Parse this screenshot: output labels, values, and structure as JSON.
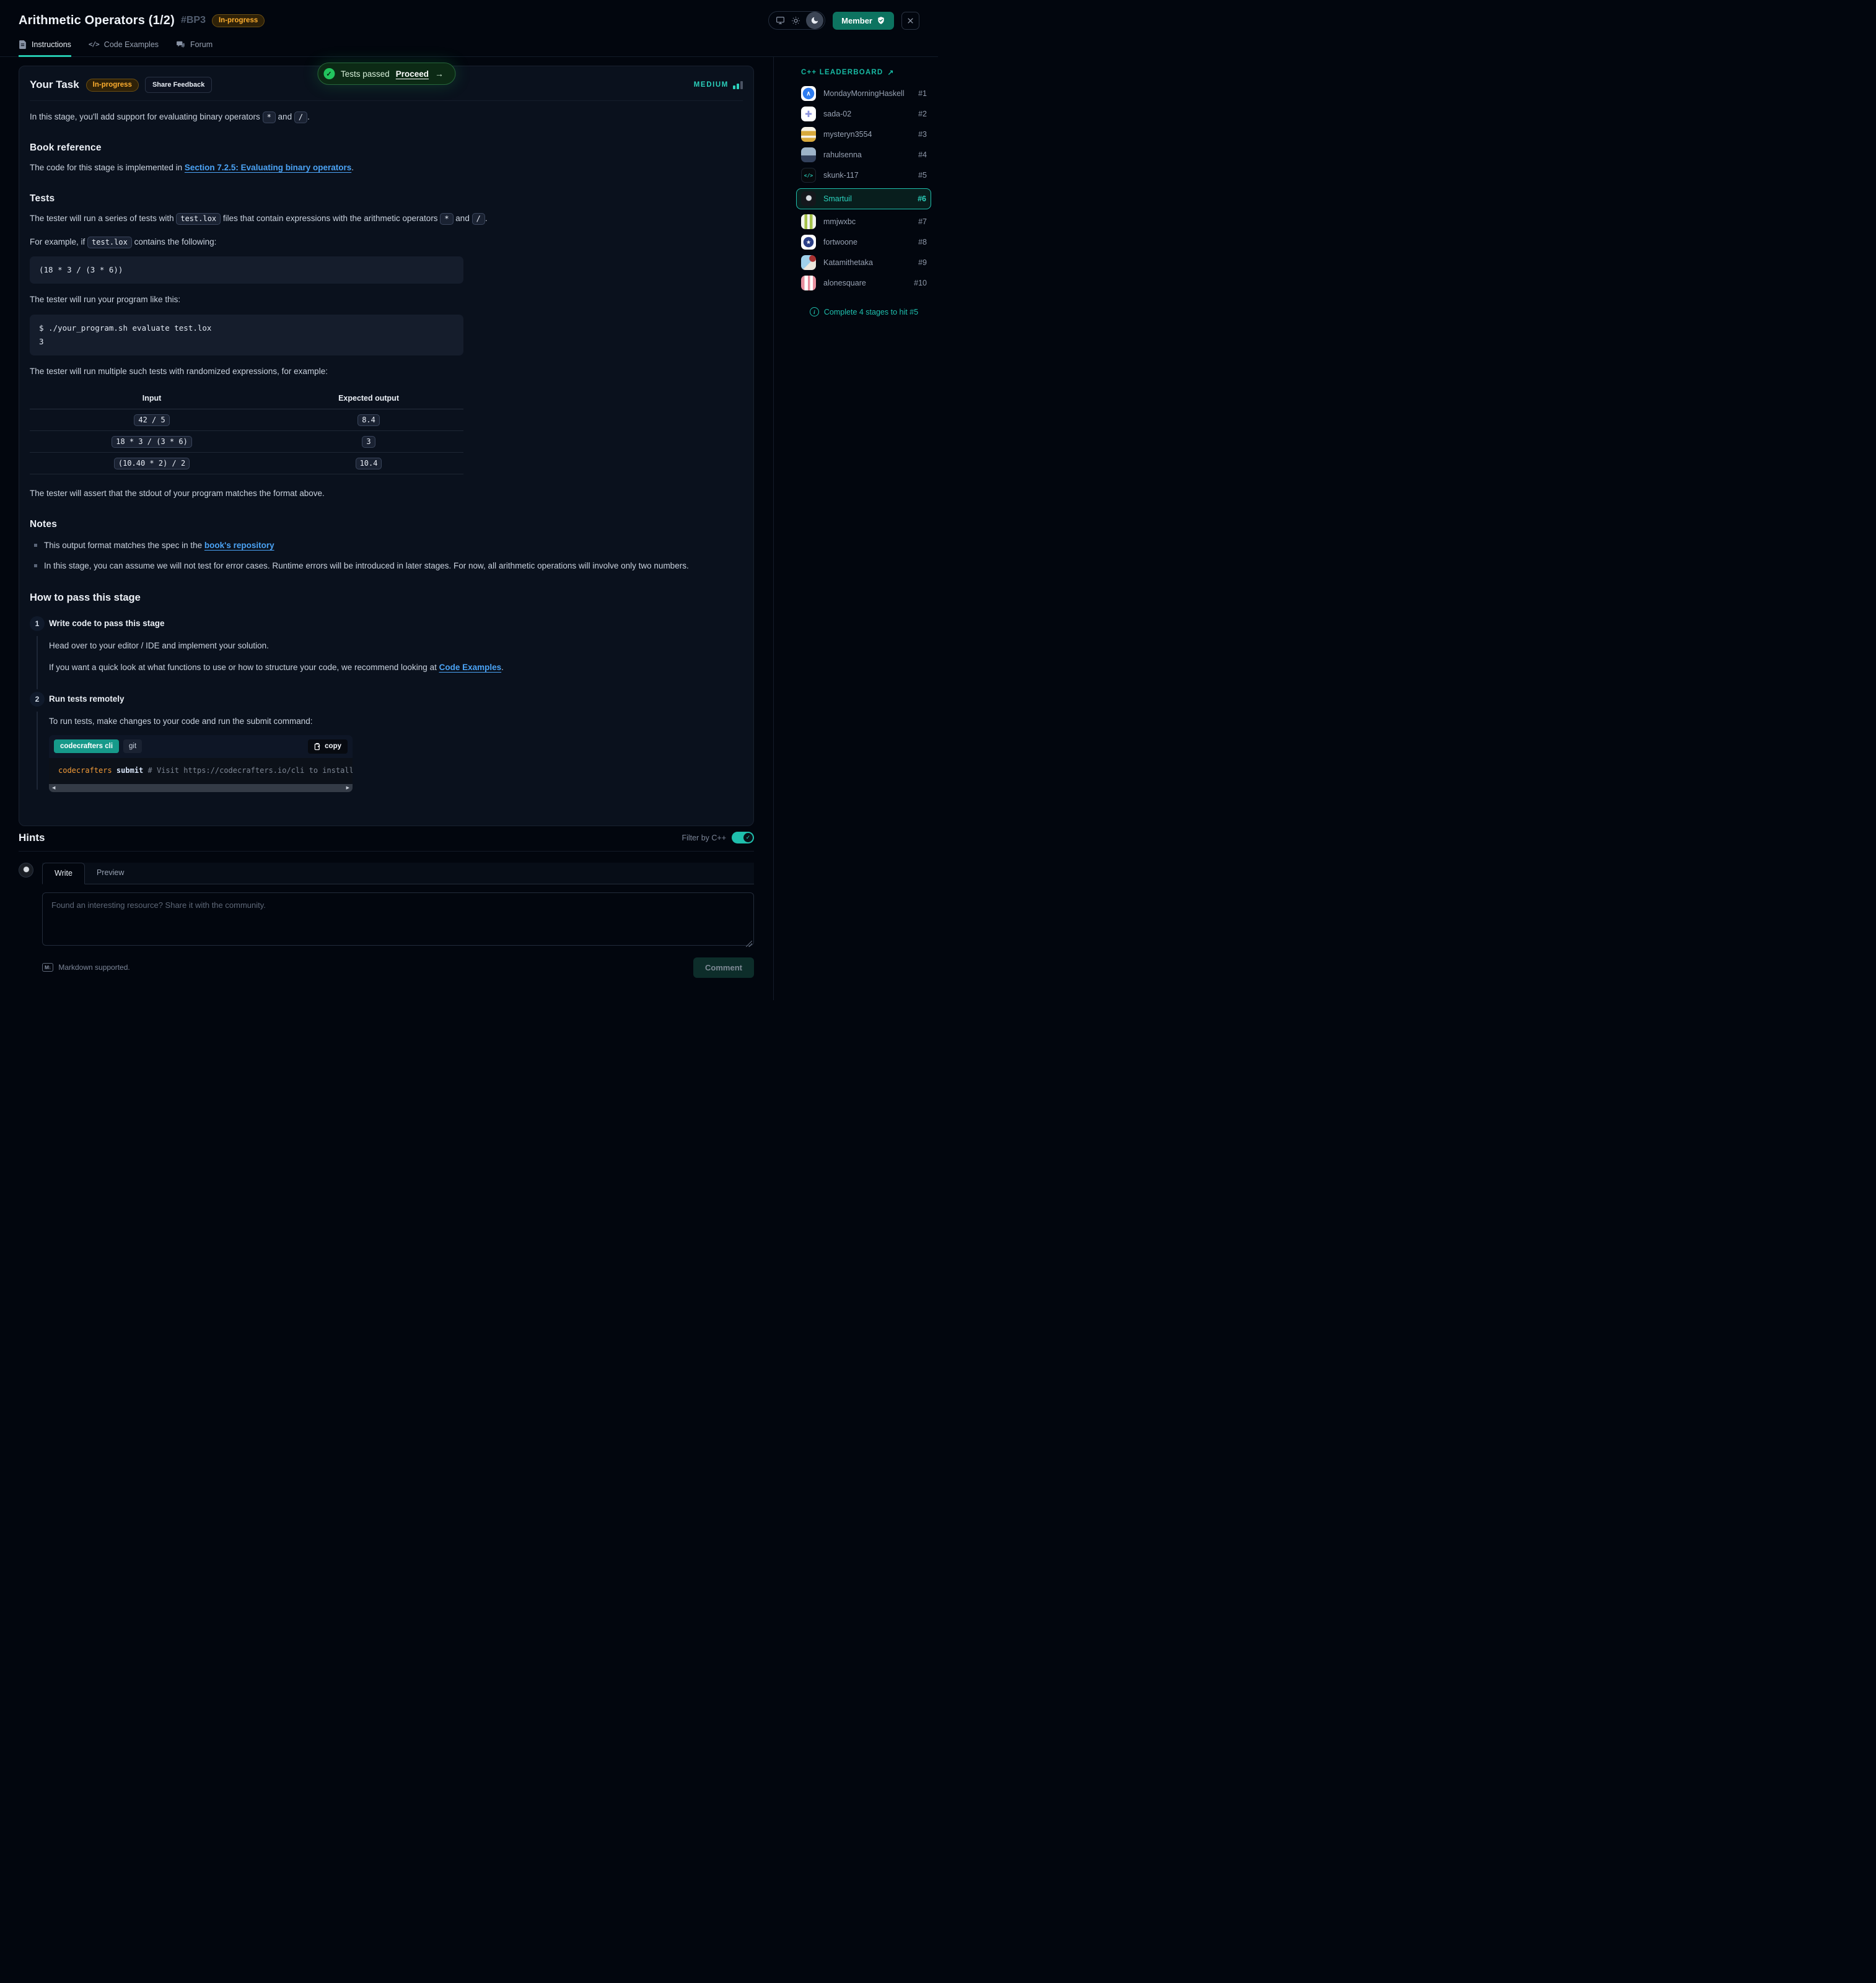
{
  "colors": {
    "accent_teal": "#1FBFAD",
    "status_amber": "#FFAE2E",
    "link_blue": "#4BA3F5",
    "success_green": "#22C55E",
    "member_teal": "#0D7360"
  },
  "header": {
    "title": "Arithmetic Operators (1/2)",
    "stage_id": "#BP3",
    "status_badge": "In-progress",
    "member_label": "Member"
  },
  "tabs": {
    "instructions": "Instructions",
    "code_examples": "Code Examples",
    "forum": "Forum"
  },
  "toast": {
    "status": "Tests passed",
    "action": "Proceed",
    "arrow": "→",
    "check_icon": "✓"
  },
  "task": {
    "heading": "Your Task",
    "status_badge": "In-progress",
    "share_feedback": "Share Feedback",
    "difficulty": "MEDIUM",
    "intro": [
      "In this stage, you'll add support for evaluating binary operators ",
      "*",
      " and ",
      "/",
      "."
    ]
  },
  "book": {
    "heading": "Book reference",
    "p": [
      "The code for this stage is implemented in ",
      "Section 7.2.5: Evaluating binary operators",
      "."
    ]
  },
  "tests": {
    "heading": "Tests",
    "p1": [
      "The tester will run a series of tests with ",
      "test.lox",
      " files that contain expressions with the arithmetic operators ",
      "*",
      " and ",
      "/",
      "."
    ],
    "p2": [
      "For example, if ",
      "test.lox",
      " contains the following:"
    ],
    "code1": "(18 * 3 / (3 * 6))",
    "p3": "The tester will run your program like this:",
    "code2_line1": "$ ./your_program.sh evaluate test.lox",
    "code2_line2": "3",
    "p4": "The tester will run multiple such tests with randomized expressions, for example:",
    "table": {
      "headers": [
        "Input",
        "Expected output"
      ],
      "rows": [
        {
          "input": "42 / 5",
          "output": "8.4"
        },
        {
          "input": "18 * 3 / (3 * 6)",
          "output": "3"
        },
        {
          "input": "(10.40 * 2) / 2",
          "output": "10.4"
        }
      ]
    },
    "p5": "The tester will assert that the stdout of your program matches the format above."
  },
  "notes": {
    "heading": "Notes",
    "item1": [
      "This output format matches the spec in the ",
      "book's repository"
    ],
    "item2": "In this stage, you can assume we will not test for error cases. Runtime errors will be introduced in later stages. For now, all arithmetic operations will involve only two numbers."
  },
  "how_to": {
    "heading": "How to pass this stage",
    "step1": {
      "number": "1",
      "title": "Write code to pass this stage",
      "p1": "Head over to your editor / IDE and implement your solution.",
      "p2": [
        "If you want a quick look at what functions to use or how to structure your code, we recommend looking at ",
        "Code Examples",
        "."
      ]
    },
    "step2": {
      "number": "2",
      "title": "Run tests remotely",
      "p": "To run tests, make changes to your code and run the submit command:",
      "cli": {
        "tab_active": "codecrafters cli",
        "tab_git": "git",
        "copy_label": "copy",
        "code_cmd": "codecrafters",
        "code_sub": " submit",
        "code_comment": " # Visit https://codecrafters.io/cli to install"
      }
    }
  },
  "hints": {
    "heading": "Hints",
    "filter_label": "Filter by C++",
    "tab_write": "Write",
    "tab_preview": "Preview",
    "placeholder": "Found an interesting resource? Share it with the community.",
    "markdown_icon": "M↓",
    "markdown_note": "Markdown supported.",
    "comment_button": "Comment"
  },
  "leaderboard": {
    "title": "C++ LEADERBOARD",
    "external_arrow": "↗",
    "entries": [
      {
        "name": "MondayMorningHaskell",
        "rank": "#1"
      },
      {
        "name": "sada-02",
        "rank": "#2"
      },
      {
        "name": "mysteryn3554",
        "rank": "#3"
      },
      {
        "name": "rahulsenna",
        "rank": "#4"
      },
      {
        "name": "skunk-117",
        "rank": "#5"
      },
      {
        "name": "Smartuil",
        "rank": "#6"
      },
      {
        "name": "mmjwxbc",
        "rank": "#7"
      },
      {
        "name": "fortwoone",
        "rank": "#8"
      },
      {
        "name": "Katamithetaka",
        "rank": "#9"
      },
      {
        "name": "alonesquare",
        "rank": "#10"
      }
    ],
    "note": "Complete 4 stages to hit #5"
  }
}
